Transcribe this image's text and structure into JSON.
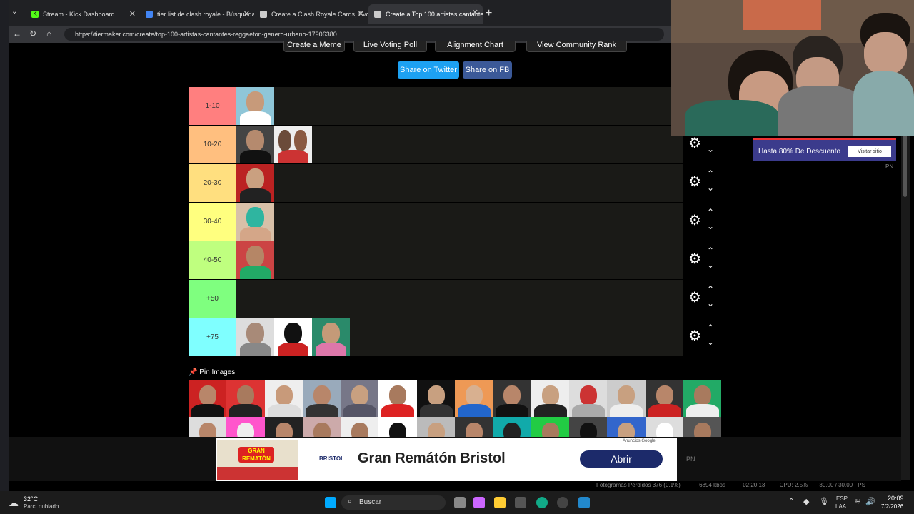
{
  "browser": {
    "tabs": [
      {
        "title": "Stream - Kick Dashboard",
        "active": false
      },
      {
        "title": "tier list de clash royale - Búsqueda",
        "active": false
      },
      {
        "title": "Create a Clash Royale Cards, Evos",
        "active": false
      },
      {
        "title": "Create a Top 100 artistas cantante",
        "active": true
      }
    ],
    "url": "https://tiermaker.com/create/top-100-artistas-cantantes-reggaeton-genero-urbano-17906380"
  },
  "page": {
    "top_buttons": [
      "Create a Meme",
      "Live Voting Poll",
      "Alignment Chart",
      "View Community Rank"
    ],
    "share_twitter": "Share on Twitter",
    "share_fb": "Share on FB",
    "tiers": [
      {
        "label": "1-10",
        "color": "#ff7f7f",
        "count": 1
      },
      {
        "label": "10-20",
        "color": "#ffbf7f",
        "count": 2
      },
      {
        "label": "20-30",
        "color": "#ffdf7f",
        "count": 1
      },
      {
        "label": "30-40",
        "color": "#ffff7f",
        "count": 1
      },
      {
        "label": "40-50",
        "color": "#bfff7f",
        "count": 1
      },
      {
        "label": "+50",
        "color": "#7fff7f",
        "count": 0
      },
      {
        "label": "+75",
        "color": "#7fffff",
        "count": 3
      }
    ],
    "pin_images_label": "Pin Images"
  },
  "side_ad": {
    "text": "Hasta 80% De Descuento",
    "button": "Visitar sitio",
    "tag": "PN"
  },
  "bottom_ad": {
    "brand": "BRISTOL",
    "title": "Gran Remtón Bristol",
    "title_exact": "Gran Remátón Bristol",
    "button": "Abrir",
    "tag": "Anuncios Google",
    "image_text": "GRAN REMATÓN",
    "pn": "PN"
  },
  "obs_status": {
    "dropped": "Fotogramas Perdidos 376 (0.1%)",
    "kbps": "6894 kbps",
    "time": "02:20:13",
    "cpu": "CPU: 2.5%",
    "fps": "30.00 / 30.00 FPS"
  },
  "taskbar": {
    "weather_temp": "32°C",
    "weather_desc": "Parc. nublado",
    "search": "Buscar",
    "lang_top": "ESP",
    "lang_bottom": "LAA",
    "time": "20:09",
    "date": "7/2/2026"
  }
}
